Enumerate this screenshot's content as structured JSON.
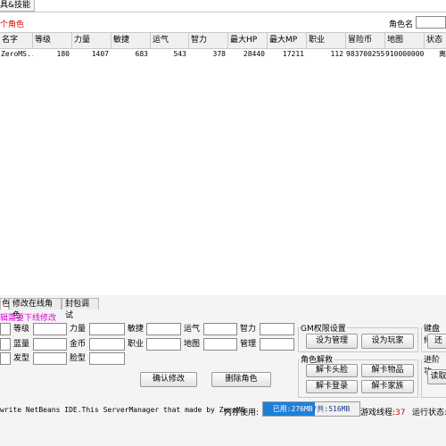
{
  "top_tab": "具&技能",
  "info_red": "个角色",
  "search": {
    "label": "角色名"
  },
  "table": {
    "headers": [
      "名字",
      "等级",
      "力量",
      "敏捷",
      "运气",
      "智力",
      "最大HP",
      "最大MP",
      "职业",
      "冒险币",
      "地图",
      "状态"
    ],
    "rows": [
      [
        "ZeroMS...",
        "180",
        "1407",
        "683",
        "543",
        "378",
        "28440",
        "17211",
        "112",
        "983700255",
        "910000000",
        "离"
      ]
    ]
  },
  "tabs": [
    "色",
    "修改在线角色",
    "封包调试"
  ],
  "edit_hint": "辑需要下线修改",
  "fields": {
    "row1": [
      "等级",
      "力量",
      "敏捷",
      "运气",
      "智力"
    ],
    "row2": [
      "蓝量",
      "金币",
      "职业",
      "地图",
      "管理"
    ],
    "row3": [
      "发型",
      "脸型"
    ]
  },
  "buttons": {
    "confirm": "确认修改",
    "delete": "删除角色"
  },
  "gm_group": {
    "title": "GM权限设置",
    "set_admin": "设为管理",
    "set_player": "设为玩家"
  },
  "unlock_group": {
    "title": "角色解救",
    "unlock_avatar": "解卡头脸",
    "unlock_items": "解卡物品",
    "unlock_login": "解卡登录",
    "unlock_family": "解卡家族"
  },
  "right_group1": {
    "title": "键盘修",
    "btn": "还"
  },
  "right_group2": {
    "title": "进阶功",
    "btn": "读取"
  },
  "status": {
    "ide_text": "write NetBeans IDE.This ServerManager that made by ZeroMS",
    "mem_label": "内存使用:",
    "mem_used": "已用:276MB",
    "mem_total": "/共:516MB",
    "mem_fraction": 0.535,
    "threads_label": "游戏线程:",
    "threads_value": "37",
    "run_status": "运行状态:"
  },
  "colors": {
    "red": "#e00000",
    "pink": "#e000e0",
    "memory_bar": "#1e7fd8"
  }
}
